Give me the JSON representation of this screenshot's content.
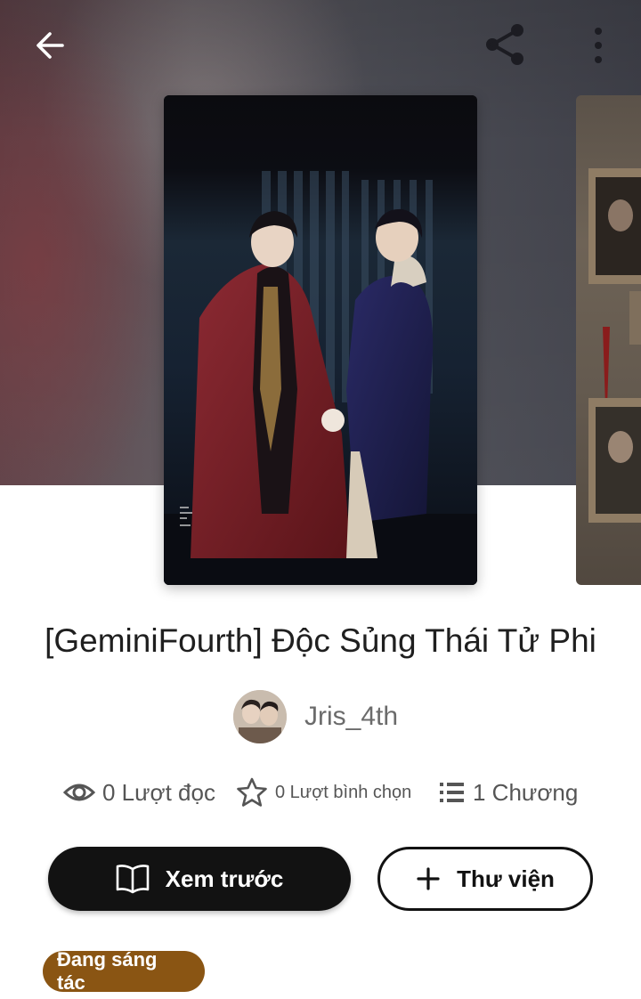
{
  "story": {
    "title": "[GeminiFourth] Độc Sủng Thái Tử Phi",
    "author": "Jris_4th",
    "status": "Đang sáng tác"
  },
  "stats": {
    "reads": "0 Lượt đọc",
    "votes": "0 Lượt bình chọn",
    "chapters": "1 Chương"
  },
  "actions": {
    "preview_label": "Xem trước",
    "library_label": "Thư viện"
  },
  "icons": {
    "back": "arrow-left-icon",
    "share": "share-icon",
    "more": "more-vertical-icon",
    "reads": "eye-icon",
    "votes": "star-outline-icon",
    "chapters": "list-icon",
    "preview": "open-book-icon",
    "library": "plus-icon"
  },
  "colors": {
    "primary_button": "#121212",
    "status_badge": "#8a5513",
    "stat_text": "#555555"
  }
}
